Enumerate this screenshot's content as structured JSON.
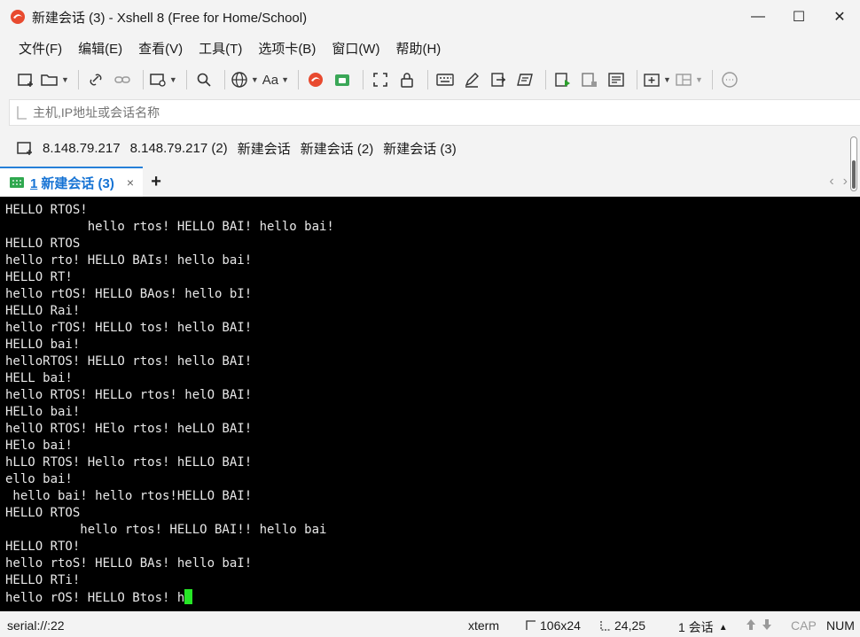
{
  "window": {
    "title": "新建会话 (3) - Xshell 8 (Free for Home/School)",
    "controls": [
      "—",
      "☐",
      "✕"
    ]
  },
  "menu": [
    "文件(F)",
    "编辑(E)",
    "查看(V)",
    "工具(T)",
    "选项卡(B)",
    "窗口(W)",
    "帮助(H)"
  ],
  "address": {
    "placeholder": "主机,IP地址或会话名称",
    "value": ""
  },
  "sessions": [
    "8.148.79.217",
    "8.148.79.217 (2)",
    "新建会话",
    "新建会话 (2)",
    "新建会话 (3)"
  ],
  "tab": {
    "number": "1",
    "label": "新建会话 (3)",
    "close": "×",
    "add": "+",
    "nav_prev": "‹",
    "nav_next": "›"
  },
  "terminal": {
    "lines": [
      "HELLO RTOS!",
      "           hello rtos! HELLO BAI! hello bai!",
      "HELLO RTOS",
      "hello rto! HELLO BAIs! hello bai!",
      "HELLO RT!",
      "hello rtOS! HELLO BAos! hello bI!",
      "HELLO Rai!",
      "hello rTOS! HELLO tos! hello BAI!",
      "HELLO bai!",
      "helloRTOS! HELLO rtos! hello BAI!",
      "HELL bai!",
      "hello RTOS! HELLo rtos! helO BAI!",
      "HELlo bai!",
      "hellO RTOS! HElo rtos! heLLO BAI!",
      "HElo bai!",
      "hLLO RTOS! Hello rtos! hELLO BAI!",
      "ello bai!",
      " hello bai! hello rtos!HELLO BAI!",
      "HELLO RTOS",
      "          hello rtos! HELLO BAI!! hello bai",
      "HELLO RTO!",
      "hello rtoS! HELLO BAs! hello baI!",
      "HELLO RTi!",
      "hello rOS! HELLO Btos! h"
    ],
    "cursor_color": "#26e626"
  },
  "status": {
    "connection": "serial://:22",
    "term_type": "xterm",
    "size": "106x24",
    "cursor_pos": "24,25",
    "session_count": "1 会话",
    "cap": "CAP",
    "num": "NUM"
  },
  "colors": {
    "tab_accent": "#2680d8",
    "tab_text": "#1673d4",
    "terminal_bg": "#000000",
    "terminal_fg": "#e8e8e8"
  }
}
